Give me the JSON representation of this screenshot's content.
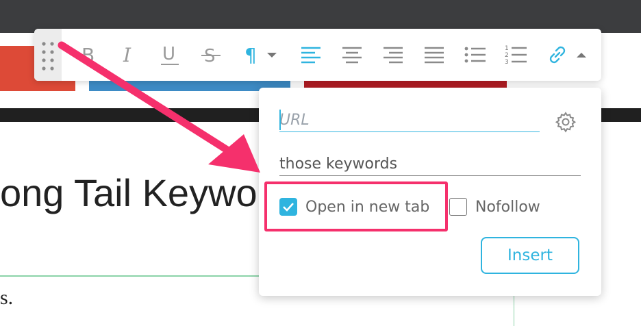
{
  "background": {
    "heading_fragment": "ong Tail Keywor",
    "text_fragment": "s."
  },
  "toolbar": {
    "items": [
      {
        "name": "drag-handle-icon"
      },
      {
        "name": "bold-icon"
      },
      {
        "name": "italic-icon"
      },
      {
        "name": "underline-icon"
      },
      {
        "name": "strikethrough-icon"
      },
      {
        "name": "paragraph-icon"
      },
      {
        "name": "caret-down-icon"
      },
      {
        "name": "align-left-icon"
      },
      {
        "name": "align-center-icon"
      },
      {
        "name": "align-right-icon"
      },
      {
        "name": "align-justify-icon"
      },
      {
        "name": "bullet-list-icon"
      },
      {
        "name": "numbered-list-icon"
      },
      {
        "name": "link-icon"
      },
      {
        "name": "caret-up-icon"
      }
    ],
    "accent_color": "#2fb4df"
  },
  "link_popup": {
    "url_placeholder": "URL",
    "url_value": "",
    "title_value": "those keywords",
    "open_new_tab_label": "Open in new tab",
    "open_new_tab_checked": true,
    "nofollow_label": "Nofollow",
    "nofollow_checked": false,
    "insert_label": "Insert",
    "settings_icon": "gear-icon"
  },
  "annotation": {
    "color": "#f5306c"
  }
}
